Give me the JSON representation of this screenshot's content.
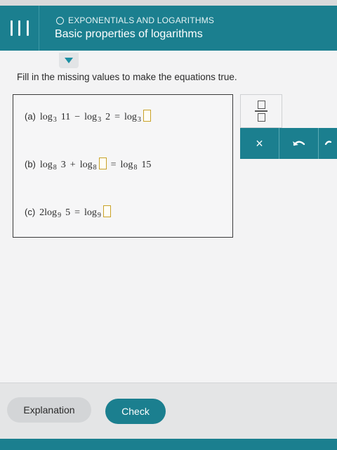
{
  "header": {
    "topic": "EXPONENTIALS AND LOGARITHMS",
    "title": "Basic properties of logarithms",
    "menu_icon": "hamburger-menu-icon"
  },
  "instruction": "Fill in the missing values to make the equations true.",
  "problems": [
    {
      "label": "(a)",
      "t1": "log",
      "b1": "3",
      "a1": "11",
      "op": "−",
      "t2": "log",
      "b2": "3",
      "a2": "2",
      "eq": "=",
      "t3": "log",
      "b3": "3"
    },
    {
      "label": "(b)",
      "t1": "log",
      "b1": "8",
      "a1": "3",
      "op": "+",
      "t2": "log",
      "b2": "8",
      "eq": "=",
      "t3": "log",
      "b3": "8",
      "a3": "15"
    },
    {
      "label": "(c)",
      "coef": "2",
      "t1": "log",
      "b1": "9",
      "a1": "5",
      "eq": "=",
      "t2": "log",
      "b2": "9"
    }
  ],
  "toolbar": {
    "fraction_icon": "fraction-icon",
    "clear_label": "×",
    "undo_icon": "undo-icon"
  },
  "footer": {
    "explanation_label": "Explanation",
    "check_label": "Check"
  },
  "colors": {
    "accent": "#1b7f8f",
    "answer_box": "#c9a227"
  }
}
